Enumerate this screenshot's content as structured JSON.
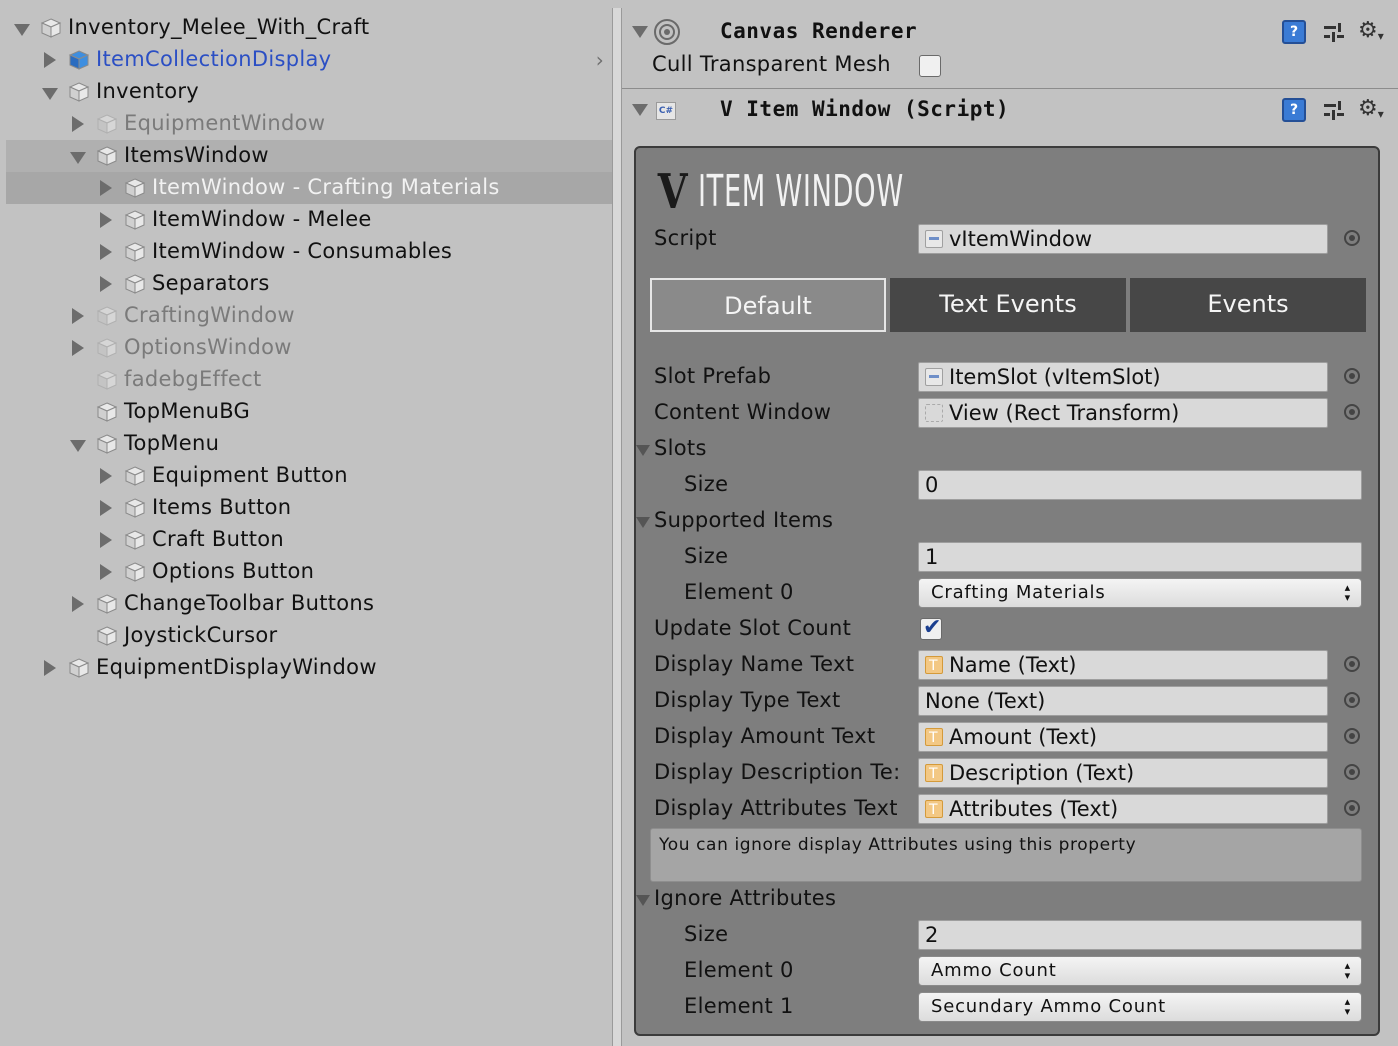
{
  "hierarchy": {
    "items": [
      {
        "label": "Inventory_Melee_With_Craft",
        "arrow": "down",
        "depth": 0,
        "style": "normal"
      },
      {
        "label": "ItemCollectionDisplay",
        "arrow": "right",
        "depth": 1,
        "style": "blue"
      },
      {
        "label": "Inventory",
        "arrow": "down",
        "depth": 1,
        "style": "normal"
      },
      {
        "label": "EquipmentWindow",
        "arrow": "right",
        "depth": 2,
        "style": "dim"
      },
      {
        "label": "ItemsWindow",
        "arrow": "down",
        "depth": 2,
        "style": "normal"
      },
      {
        "label": "ItemWindow - Crafting Materials",
        "arrow": "right",
        "depth": 3,
        "style": "white"
      },
      {
        "label": "ItemWindow - Melee",
        "arrow": "right",
        "depth": 3,
        "style": "normal"
      },
      {
        "label": "ItemWindow - Consumables",
        "arrow": "right",
        "depth": 3,
        "style": "normal"
      },
      {
        "label": "Separators",
        "arrow": "right",
        "depth": 3,
        "style": "normal"
      },
      {
        "label": "CraftingWindow",
        "arrow": "right",
        "depth": 2,
        "style": "dim"
      },
      {
        "label": "OptionsWindow",
        "arrow": "right",
        "depth": 2,
        "style": "dim"
      },
      {
        "label": "fadebgEffect",
        "arrow": "none",
        "depth": 2,
        "style": "dim"
      },
      {
        "label": "TopMenuBG",
        "arrow": "none",
        "depth": 2,
        "style": "normal"
      },
      {
        "label": "TopMenu",
        "arrow": "down",
        "depth": 2,
        "style": "normal"
      },
      {
        "label": "Equipment Button",
        "arrow": "right",
        "depth": 3,
        "style": "normal"
      },
      {
        "label": "Items Button",
        "arrow": "right",
        "depth": 3,
        "style": "normal"
      },
      {
        "label": "Craft Button",
        "arrow": "right",
        "depth": 3,
        "style": "normal"
      },
      {
        "label": "Options Button",
        "arrow": "right",
        "depth": 3,
        "style": "normal"
      },
      {
        "label": "ChangeToolbar Buttons",
        "arrow": "right",
        "depth": 2,
        "style": "normal"
      },
      {
        "label": "JoystickCursor",
        "arrow": "none",
        "depth": 2,
        "style": "normal"
      },
      {
        "label": "EquipmentDisplayWindow",
        "arrow": "right",
        "depth": 1,
        "style": "normal"
      }
    ],
    "selected_index": 5,
    "highlight_index": 4
  },
  "inspector": {
    "canvas_renderer": {
      "title": "Canvas Renderer",
      "cull_label": "Cull Transparent Mesh",
      "cull_checked": false
    },
    "script_component": {
      "title": "V Item Window (Script)",
      "logo_text": "ITEM WINDOW",
      "script_label": "Script",
      "script_value": "vItemWindow",
      "tabs": [
        "Default",
        "Text Events",
        "Events"
      ],
      "active_tab": 0,
      "slot_prefab_label": "Slot Prefab",
      "slot_prefab_value": "ItemSlot (vItemSlot)",
      "content_window_label": "Content Window",
      "content_window_value": "View (Rect Transform)",
      "slots_label": "Slots",
      "slots_size_label": "Size",
      "slots_size_value": "0",
      "supported_items_label": "Supported Items",
      "supported_size_label": "Size",
      "supported_size_value": "1",
      "supported_element0_label": "Element 0",
      "supported_element0_value": "Crafting Materials",
      "update_slot_count_label": "Update Slot Count",
      "update_slot_count_checked": true,
      "display_name_label": "Display Name Text",
      "display_name_value": "Name (Text)",
      "display_type_label": "Display Type Text",
      "display_type_value": "None (Text)",
      "display_amount_label": "Display Amount Text",
      "display_amount_value": "Amount (Text)",
      "display_desc_label": "Display Description Te:",
      "display_desc_value": "Description (Text)",
      "display_attr_label": "Display Attributes Text",
      "display_attr_value": "Attributes (Text)",
      "help_text": "You can ignore display Attributes using this property",
      "ignore_label": "Ignore Attributes",
      "ignore_size_label": "Size",
      "ignore_size_value": "2",
      "ignore_element0_label": "Element 0",
      "ignore_element0_value": "Ammo Count",
      "ignore_element1_label": "Element 1",
      "ignore_element1_value": "Secundary Ammo Count"
    }
  }
}
